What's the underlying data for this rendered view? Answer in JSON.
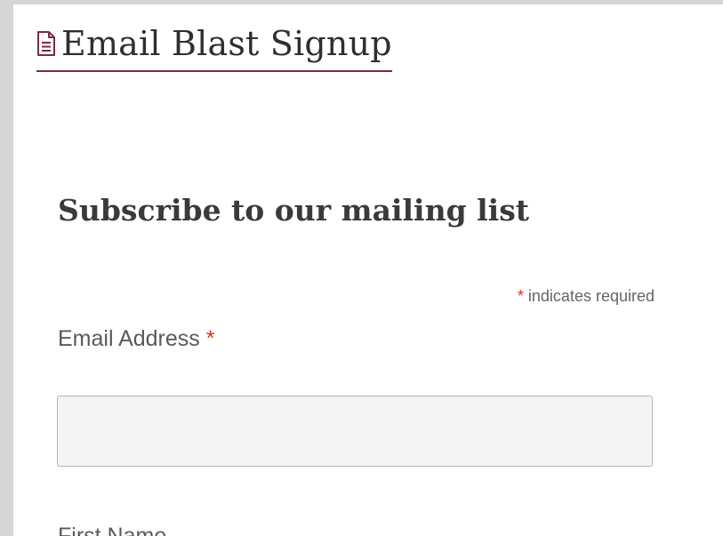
{
  "page": {
    "title": "Email Blast Signup",
    "icon": "document-icon",
    "accent_color": "#7b2a3f"
  },
  "form": {
    "heading": "Subscribe to our mailing list",
    "required_marker": "*",
    "required_note": "indicates required",
    "required_color": "#e0311a",
    "fields": [
      {
        "label": "Email Address",
        "required": true,
        "value": "",
        "placeholder": ""
      },
      {
        "label": "First Name",
        "required": false
      }
    ]
  }
}
